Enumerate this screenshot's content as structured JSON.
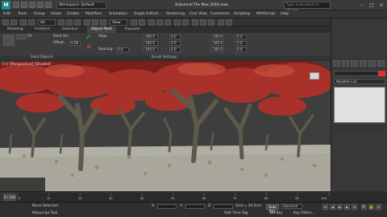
{
  "titlebar": {
    "app_icon": "max-logo",
    "workspace": "Workspace: Default",
    "title": "Autumnal Tile Max 2016.max",
    "search_placeholder": "Type a keyword or phrase"
  },
  "menu": [
    "Edit",
    "Tools",
    "Group",
    "Views",
    "Create",
    "Modifiers",
    "Animation",
    "Graph Editors",
    "Rendering",
    "Civil View",
    "Customize",
    "Scripting",
    "MAXScript",
    "Help"
  ],
  "toolbar": {
    "view_dropdown": "View",
    "all_dropdown": "All"
  },
  "ribbon_tabs": [
    "Modeling",
    "Freeform",
    "Selection",
    "Object Paint",
    "Populate"
  ],
  "ribbon_active_tab": "Object Paint",
  "ribbon": {
    "paint_on": "Paint On:",
    "offset_label": "Offset:",
    "offset_value": "0.00",
    "fill_label": "Fill",
    "align_label": "Align",
    "spacing_label": "Spacing:",
    "spacing_value": "0.0",
    "scale_x_value": "100.0",
    "scale_y_value": "100.0",
    "scale_z_value": "100.0",
    "rot_x_value": "0.0",
    "rot_y_value": "0.0",
    "rot_z_value": "0.0",
    "paint_objects_label": "Paint Objects",
    "brush_settings_label": "Brush Settings"
  },
  "viewport": {
    "label": "[+] [Perspective] [Shaded]"
  },
  "command_panel": {
    "modifier_list": "Modifier List"
  },
  "timeline": {
    "frame_display": "0 / 100",
    "ticks": [
      "0",
      "10",
      "20",
      "30",
      "40",
      "50",
      "60",
      "70",
      "80",
      "90",
      "100"
    ]
  },
  "status": {
    "selected": "None Selected",
    "x_label": "X:",
    "y_label": "Y:",
    "z_label": "Z:",
    "grid": "Grid = 10.0cm",
    "autokey": "Auto Key",
    "selected_dd": "Selected",
    "setkey": "Set Key",
    "key_filters": "Key Filters...",
    "add_time_tag": "Add Time Tag",
    "maxscript": "Maxscript Tool"
  },
  "colors": {
    "foliage": "#a8322a",
    "foliage_dark": "#7a1f1a",
    "trunk": "#5e5a4a",
    "ground": "#a9a79c",
    "sky": "#3e3e3e"
  }
}
